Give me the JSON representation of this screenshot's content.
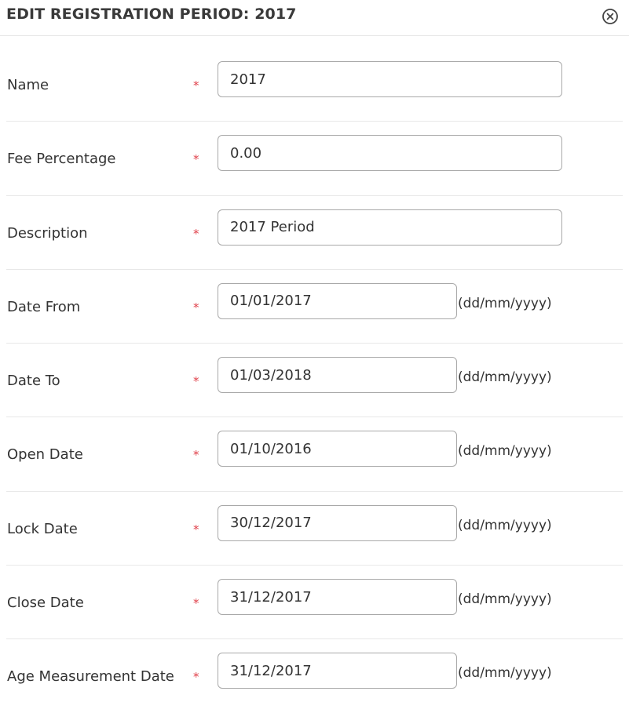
{
  "dialog": {
    "title": "EDIT REGISTRATION PERIOD: 2017"
  },
  "form": {
    "required_mark": "*",
    "date_hint": "(dd/mm/yyyy)",
    "fields": [
      {
        "label": "Name",
        "value": "2017"
      },
      {
        "label": "Fee Percentage",
        "value": "0.00"
      },
      {
        "label": "Description",
        "value": "2017 Period"
      },
      {
        "label": "Date From",
        "value": "01/01/2017"
      },
      {
        "label": "Date To",
        "value": "01/03/2018"
      },
      {
        "label": "Open Date",
        "value": "01/10/2016"
      },
      {
        "label": "Lock Date",
        "value": "30/12/2017"
      },
      {
        "label": "Close Date",
        "value": "31/12/2017"
      },
      {
        "label": "Age Measurement Date",
        "value": "31/12/2017"
      }
    ]
  }
}
